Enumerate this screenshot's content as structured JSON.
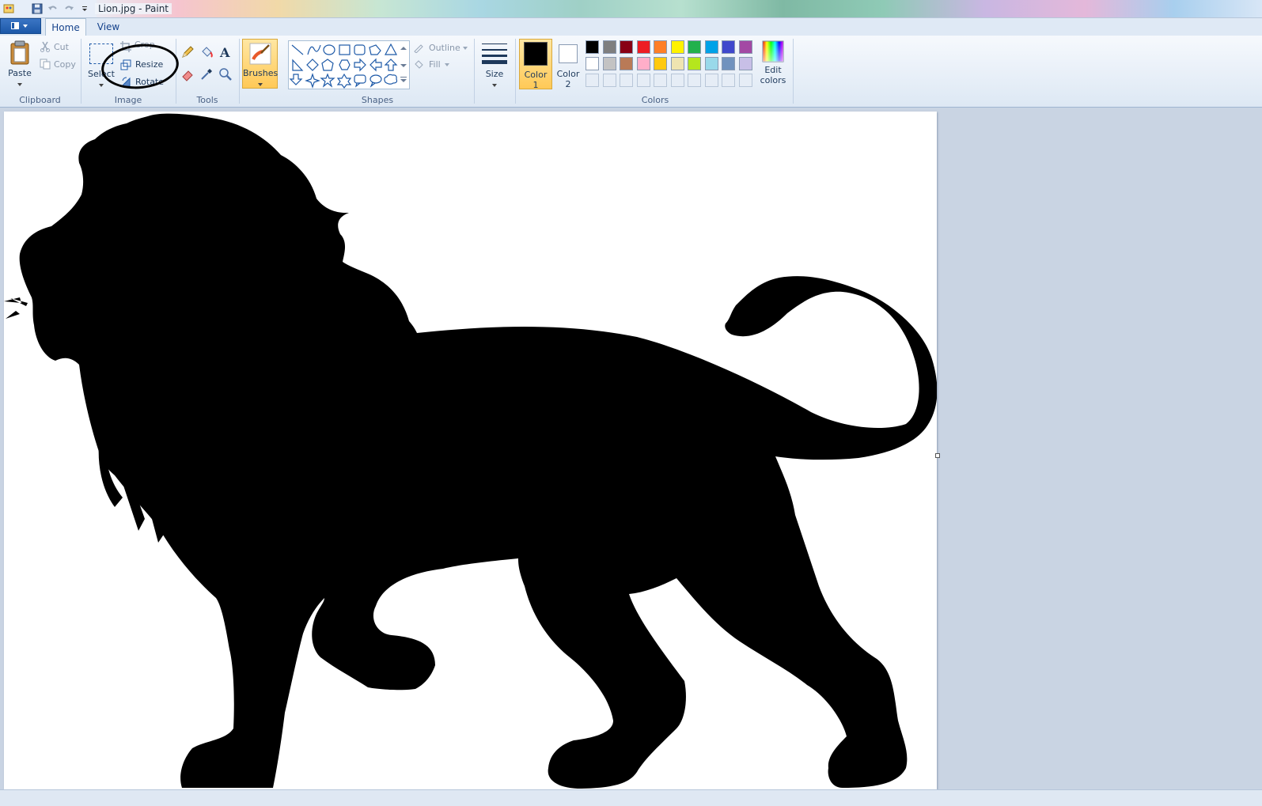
{
  "window": {
    "title": "Lion.jpg - Paint"
  },
  "tabs": [
    {
      "label": "Home",
      "active": true
    },
    {
      "label": "View",
      "active": false
    }
  ],
  "clipboard": {
    "paste": "Paste",
    "cut": "Cut",
    "copy": "Copy",
    "group": "Clipboard"
  },
  "image": {
    "select": "Select",
    "crop": "Crop",
    "resize": "Resize",
    "rotate": "Rotate",
    "group": "Image"
  },
  "tools": {
    "group": "Tools"
  },
  "brushes": {
    "label": "Brushes"
  },
  "shapes": {
    "outline": "Outline",
    "fill": "Fill",
    "group": "Shapes"
  },
  "size": {
    "label": "Size"
  },
  "colors": {
    "color1": "Color",
    "color1_num": "1",
    "color2": "Color",
    "color2_num": "2",
    "edit": "Edit",
    "edit2": "colors",
    "group": "Colors",
    "color1_value": "#000000",
    "color2_value": "#ffffff",
    "palette_row1": [
      "#000000",
      "#7f7f7f",
      "#880015",
      "#ed1c24",
      "#ff7f27",
      "#fff200",
      "#22b14c",
      "#00a2e8",
      "#3f48cc",
      "#a349a4"
    ],
    "palette_row2": [
      "#ffffff",
      "#c3c3c3",
      "#b97a57",
      "#ffaec9",
      "#ffc90e",
      "#efe4b0",
      "#b5e61d",
      "#99d9ea",
      "#7092be",
      "#c8bfe7"
    ]
  }
}
